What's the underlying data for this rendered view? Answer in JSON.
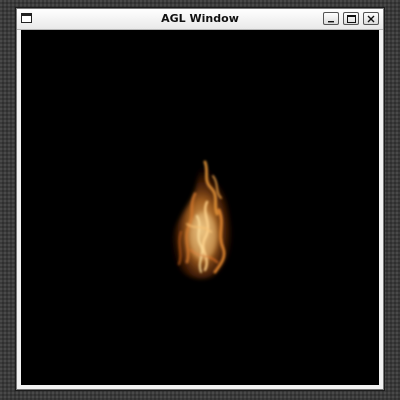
{
  "window": {
    "title": "AGL Window",
    "controls": [
      "minimize",
      "maximize",
      "close"
    ],
    "icons": {
      "system_menu": "window-menu-icon",
      "minimize": "minimize-icon",
      "maximize": "maximize-icon",
      "close": "close-icon"
    }
  },
  "canvas": {
    "background": "#000000",
    "content": "fire-particle-effect"
  },
  "colors": {
    "flame_core": "#ffe2a0",
    "flame_mid": "#e89a3c",
    "flame_edge": "#7a2a08",
    "titlebar": "#f2f2f2"
  }
}
